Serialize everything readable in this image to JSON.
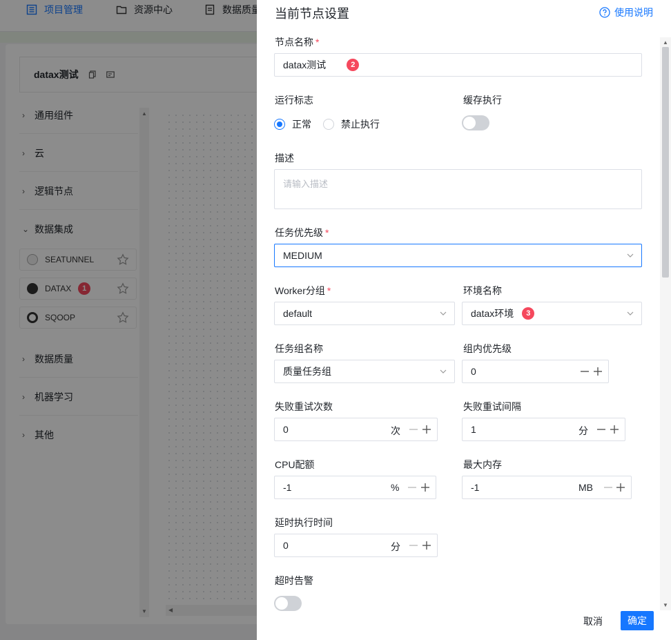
{
  "topbar": {
    "project_mgmt": "项目管理",
    "resource_center": "资源中心",
    "data_quality": "数据质量"
  },
  "workflow": {
    "name": "datax测试",
    "categories": [
      "通用组件",
      "云",
      "逻辑节点",
      "数据集成",
      "数据质量",
      "机器学习",
      "其他"
    ],
    "components": [
      {
        "label": "SEATUNNEL"
      },
      {
        "label": "DATAX",
        "badge": "1"
      },
      {
        "label": "SQOOP"
      }
    ]
  },
  "drawer": {
    "title": "当前节点设置",
    "help": "使用说明",
    "node_name": {
      "label": "节点名称",
      "value": "datax测试",
      "badge": "2"
    },
    "run_flag": {
      "label": "运行标志",
      "options": [
        "正常",
        "禁止执行"
      ],
      "selected": "正常"
    },
    "cache_exec": {
      "label": "缓存执行",
      "on": false
    },
    "desc": {
      "label": "描述",
      "placeholder": "请输入描述"
    },
    "priority": {
      "label": "任务优先级",
      "value": "MEDIUM"
    },
    "worker_group": {
      "label": "Worker分组",
      "value": "default"
    },
    "env_name": {
      "label": "环境名称",
      "value": "datax环境",
      "badge": "3"
    },
    "task_group": {
      "label": "任务组名称",
      "value": "质量任务组"
    },
    "group_priority": {
      "label": "组内优先级",
      "value": "0"
    },
    "retry_times": {
      "label": "失败重试次数",
      "value": "0",
      "unit": "次"
    },
    "retry_interval": {
      "label": "失败重试间隔",
      "value": "1",
      "unit": "分"
    },
    "cpu_quota": {
      "label": "CPU配额",
      "value": "-1",
      "unit": "%"
    },
    "max_memory": {
      "label": "最大内存",
      "value": "-1",
      "unit": "MB"
    },
    "delay_time": {
      "label": "延时执行时间",
      "value": "0",
      "unit": "分"
    },
    "timeout_alarm": {
      "label": "超时告警",
      "on": false
    },
    "cancel": "取消",
    "confirm": "确定"
  },
  "colors": {
    "accent": "#1677ff",
    "badge": "#f5485d"
  }
}
